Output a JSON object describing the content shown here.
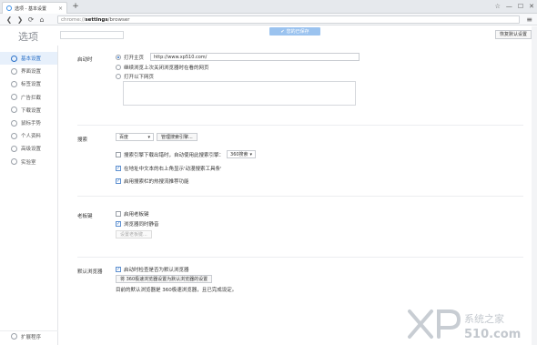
{
  "tab": {
    "title": "选项 - 基本设置",
    "close": "×"
  },
  "toolbar": {
    "new_tab": "+",
    "back": "❮",
    "forward": "❯",
    "refresh": "⟳",
    "home": "⌂",
    "menu": "≡"
  },
  "window": {
    "controls": [
      "☆",
      "—",
      "☐",
      "✕"
    ]
  },
  "address": {
    "scheme": "chrome://",
    "bold": "settings",
    "rest": "/browser"
  },
  "header": {
    "title": "选项",
    "saved_banner": "您的已保存",
    "restore_defaults": "恢复默认设置"
  },
  "sidebar": {
    "items": [
      {
        "label": "基本设置",
        "active": true
      },
      {
        "label": "界面设置",
        "active": false
      },
      {
        "label": "标签设置",
        "active": false
      },
      {
        "label": "广告拦截",
        "active": false
      },
      {
        "label": "下载设置",
        "active": false
      },
      {
        "label": "鼠标手势",
        "active": false
      },
      {
        "label": "个人资料",
        "active": false
      },
      {
        "label": "高级设置",
        "active": false
      },
      {
        "label": "实验室",
        "active": false
      }
    ],
    "bottom": "扩展程序"
  },
  "startup": {
    "label": "启动时",
    "option_home": "打开主页",
    "home_url": "http://www.xp510.com/",
    "option_last": "继续浏览上次关闭浏览器时在看的网页",
    "option_specific": "打开以下网页"
  },
  "search": {
    "label": "搜索",
    "engine": "百度",
    "manage": "管理搜索引擎...",
    "fallback_text": "搜索引擎下载出错时，自动使用此搜索引擎：",
    "fallback_engine": "360搜索",
    "address_bar_text": "在地址中文本的右上角显示'动漫搜索工具条'",
    "recommend_text": "启用搜索栏的热搜流推荐功能"
  },
  "bosskey": {
    "label": "老板键",
    "enable": "启用老板键",
    "mute": "浏览器同时静音",
    "setup": "设置老板键..."
  },
  "default_browser": {
    "label": "默认浏览器",
    "check_text": "启动时检查是否为默认浏览器",
    "set_button": "将 360极速浏览器设置为默认浏览器的设置",
    "status": "目前的默认浏览器是 360极速浏览器，且已完成设定。"
  },
  "watermark": {
    "brand": "系统之家",
    "site": "510.com"
  }
}
